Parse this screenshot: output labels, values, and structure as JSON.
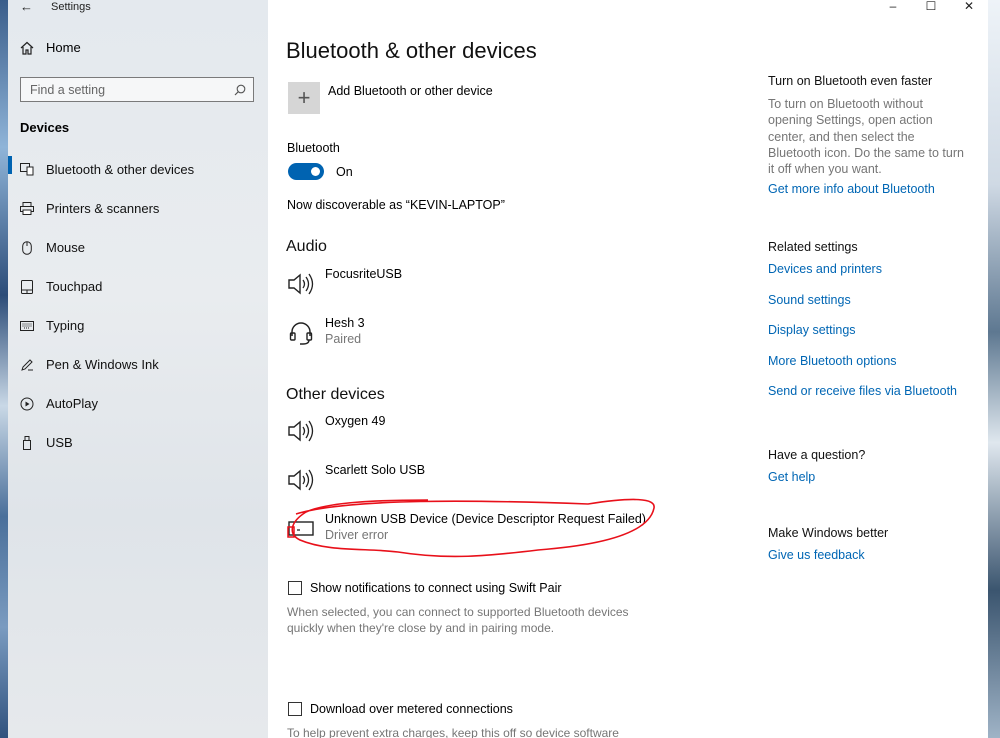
{
  "window": {
    "title": "Settings",
    "controls": {
      "minimize": "–",
      "maximize": "☐",
      "close": "✕"
    }
  },
  "sidebar": {
    "home_label": "Home",
    "search_placeholder": "Find a setting",
    "section": "Devices",
    "items": [
      {
        "label": "Bluetooth & other devices",
        "icon": "bluetooth-devices-icon",
        "active": true
      },
      {
        "label": "Printers & scanners",
        "icon": "printer-icon",
        "active": false
      },
      {
        "label": "Mouse",
        "icon": "mouse-icon",
        "active": false
      },
      {
        "label": "Touchpad",
        "icon": "touchpad-icon",
        "active": false
      },
      {
        "label": "Typing",
        "icon": "keyboard-icon",
        "active": false
      },
      {
        "label": "Pen & Windows Ink",
        "icon": "pen-icon",
        "active": false
      },
      {
        "label": "AutoPlay",
        "icon": "autoplay-icon",
        "active": false
      },
      {
        "label": "USB",
        "icon": "usb-icon",
        "active": false
      }
    ]
  },
  "main": {
    "title": "Bluetooth & other devices",
    "add_device_label": "Add Bluetooth or other device",
    "bluetooth_label": "Bluetooth",
    "bluetooth_state": "On",
    "discoverable": "Now discoverable as “KEVIN-LAPTOP”",
    "audio": {
      "title": "Audio",
      "devices": [
        {
          "name": "FocusriteUSB",
          "status": "",
          "icon": "speaker-icon"
        },
        {
          "name": "Hesh 3",
          "status": "Paired",
          "icon": "headset-icon"
        }
      ]
    },
    "other": {
      "title": "Other devices",
      "devices": [
        {
          "name": "Oxygen 49",
          "status": "",
          "icon": "speaker-icon"
        },
        {
          "name": "Scarlett Solo USB",
          "status": "",
          "icon": "speaker-icon"
        },
        {
          "name": "Unknown USB Device (Device Descriptor Request Failed)",
          "status": "Driver error",
          "icon": "usb-device-error-icon"
        }
      ]
    },
    "swift_pair": {
      "label": "Show notifications to connect using Swift Pair",
      "help": "When selected, you can connect to supported Bluetooth devices quickly when they're close by and in pairing mode."
    },
    "metered": {
      "label": "Download over metered connections",
      "help": "To help prevent extra charges, keep this off so device software"
    }
  },
  "related": {
    "faster": {
      "title": "Turn on Bluetooth even faster",
      "body": "To turn on Bluetooth without opening Settings, open action center, and then select the Bluetooth icon. Do the same to turn it off when you want.",
      "link": "Get more info about Bluetooth"
    },
    "settings": {
      "title": "Related settings",
      "links": [
        "Devices and printers",
        "Sound settings",
        "Display settings",
        "More Bluetooth options",
        "Send or receive files via Bluetooth"
      ]
    },
    "question": {
      "title": "Have a question?",
      "link": "Get help"
    },
    "better": {
      "title": "Make Windows better",
      "link": "Give us feedback"
    }
  },
  "colors": {
    "accent": "#0063b1",
    "link": "#0066b4",
    "annotation": "#e8101a"
  }
}
